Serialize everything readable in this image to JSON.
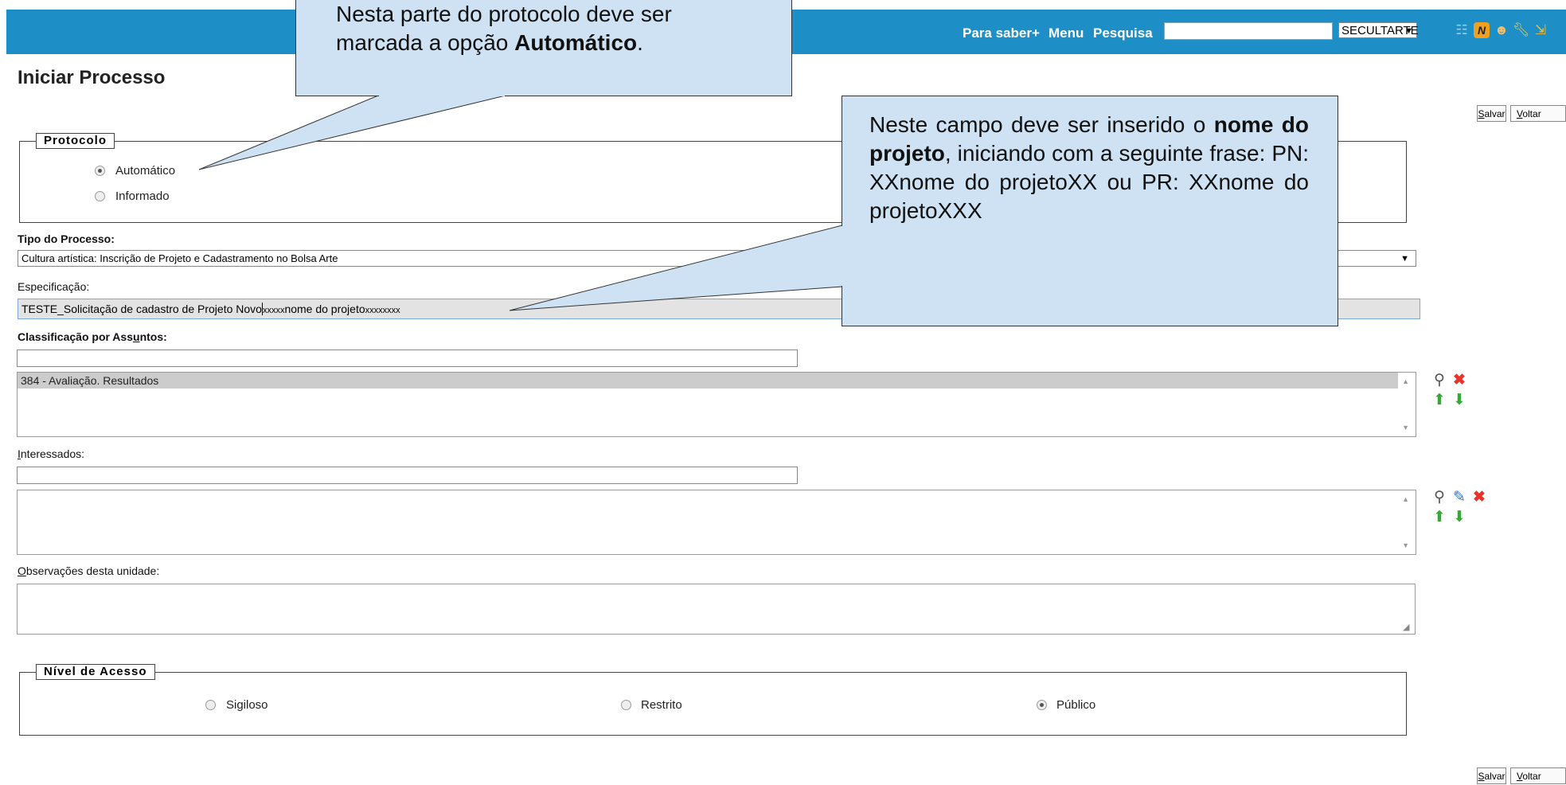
{
  "header": {
    "links": [
      "Para saber+",
      "Menu",
      "Pesquisa"
    ],
    "search_value": "",
    "unit_select": "SECULTARTE",
    "icons": [
      "list-icon",
      "notification-n-icon",
      "user-icon",
      "wrench-icon",
      "exit-icon"
    ],
    "accent_color": "#1d8fc6"
  },
  "page": {
    "title": "Iniciar Processo"
  },
  "buttons": {
    "salvar": "Salvar",
    "salvar_key": "S",
    "salvar_rest": "alvar",
    "voltar_key": "V",
    "voltar_rest": "oltar"
  },
  "protocolo": {
    "legend": "Protocolo",
    "options": [
      {
        "label": "Automático",
        "selected": true
      },
      {
        "label": "Informado",
        "selected": false
      }
    ]
  },
  "tipo_processo": {
    "label": "Tipo do Processo:",
    "value": "Cultura artística: Inscrição de Projeto e Cadastramento no Bolsa Arte"
  },
  "especificacao": {
    "label": "Especificação:",
    "value_main": "TESTE_Solicitação de cadastro de Projeto Novo",
    "value_x1": "xxxxx",
    "value_mid": "nome do projeto",
    "value_x2": "xxxxxxxx"
  },
  "classificacao": {
    "label_pre": "Classificação por Ass",
    "label_key": "u",
    "label_post": "ntos:",
    "input_value": "",
    "items": [
      "384 - Avaliação. Resultados"
    ]
  },
  "interessados": {
    "label_key": "I",
    "label_rest": "nteressados:",
    "input_value": "",
    "items": []
  },
  "observacoes": {
    "label_key": "O",
    "label_rest": "bservações desta unidade:",
    "value": ""
  },
  "nivel_acesso": {
    "legend": "Nível de Acesso",
    "options": [
      {
        "label": "Sigiloso",
        "selected": false
      },
      {
        "label": "Restrito",
        "selected": false
      },
      {
        "label": "Público",
        "selected": true
      }
    ]
  },
  "callouts": {
    "protocolo": {
      "line1": "Nesta parte do protocolo deve ser",
      "line2_pre": "marcada a opção ",
      "line2_bold": "Automático",
      "line2_post": "."
    },
    "especificacao": {
      "pre": "Neste campo deve ser inserido o ",
      "bold": "nome do projeto",
      "post": ", iniciando com a seguinte frase: PN: XXnome do projetoXX ou PR: XXnome do projetoXXX"
    }
  }
}
